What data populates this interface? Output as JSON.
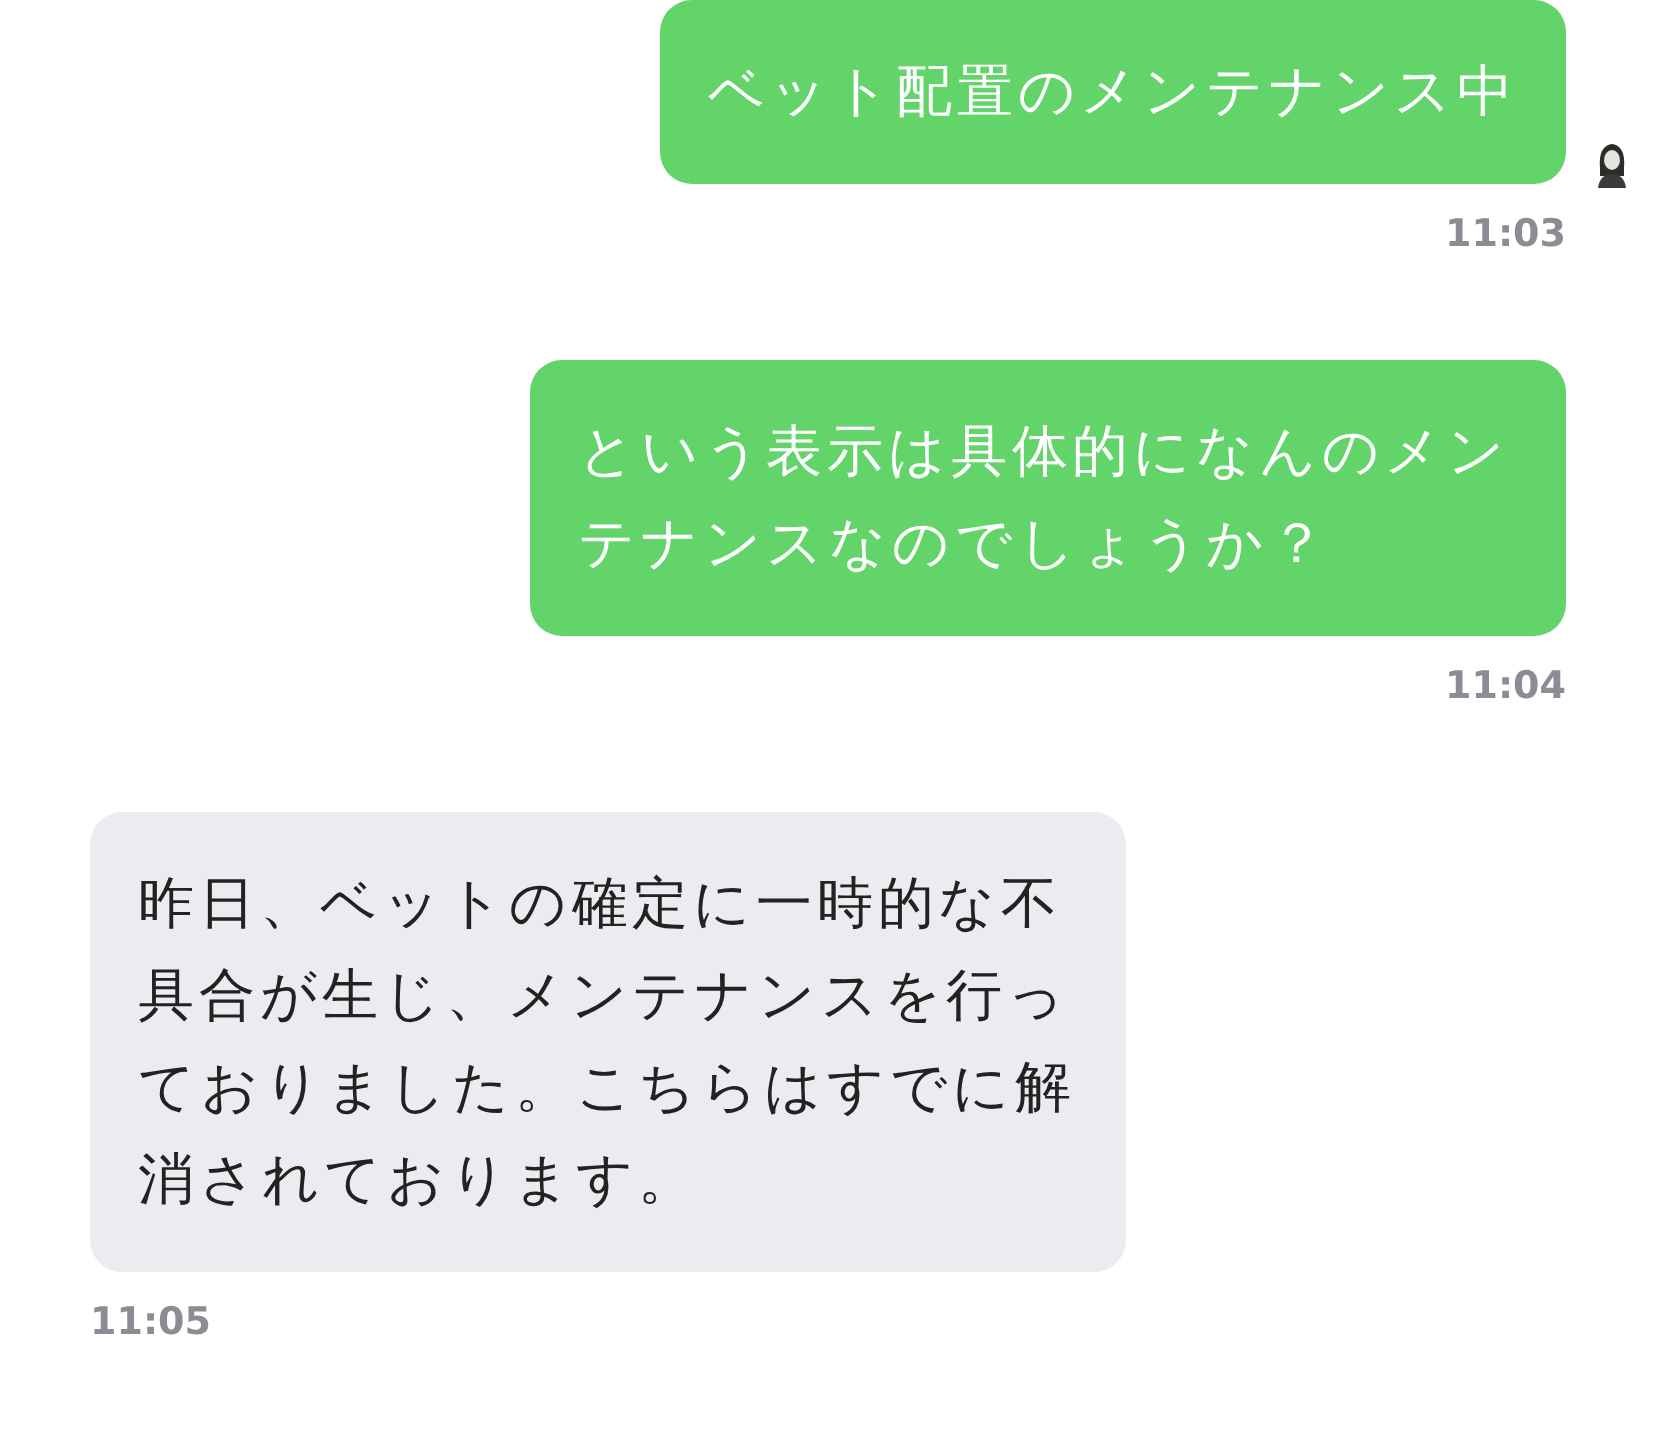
{
  "messages": [
    {
      "kind": "outgoing",
      "text": "ベット配置のメンテナンス中",
      "time": "11:03",
      "avatar": true
    },
    {
      "kind": "outgoing",
      "text": "という表示は具体的になんのメンテナンスなのでしょうか？",
      "time": "11:04",
      "avatar": false
    },
    {
      "kind": "incoming",
      "text": "昨日、ベットの確定に一時的な不具合が生じ、メンテナンスを行っておりました。こちらはすでに解消されております。",
      "time": "11:05",
      "avatar": false
    }
  ]
}
